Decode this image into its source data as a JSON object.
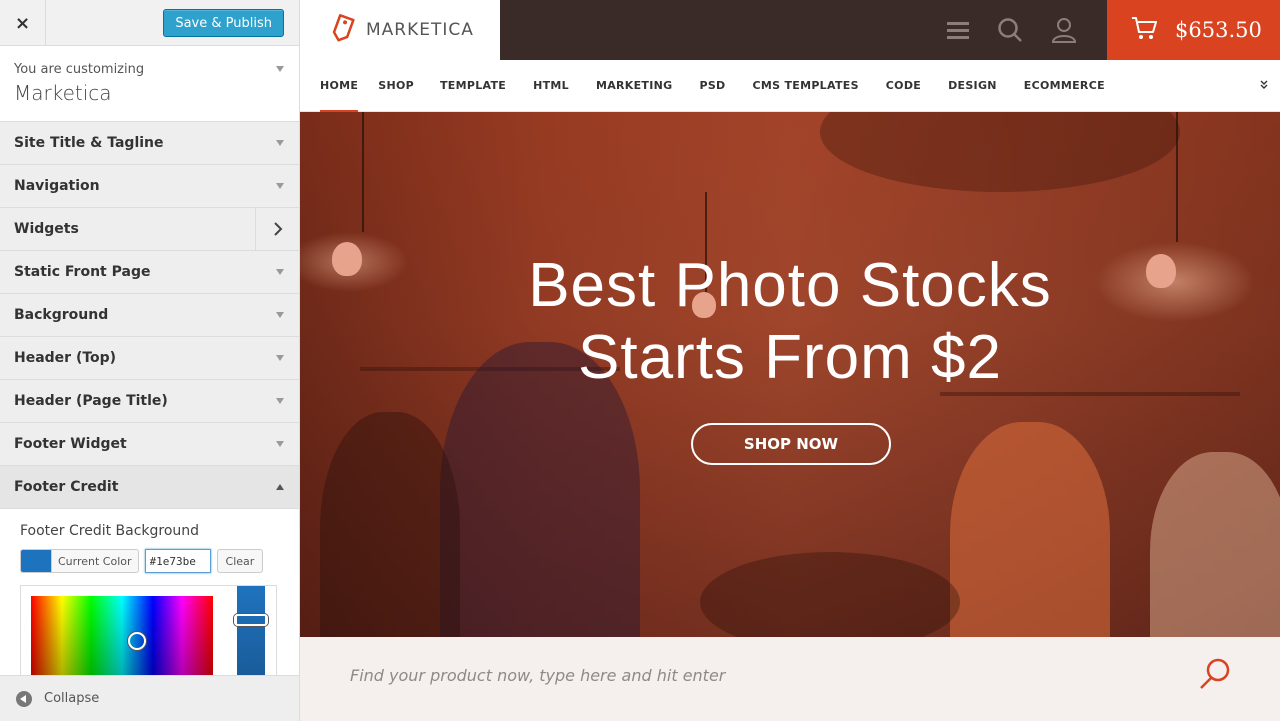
{
  "customizer": {
    "close_label": "×",
    "save_label": "Save & Publish",
    "customizing_prefix": "You are customizing",
    "theme_name": "Marketica",
    "sections": [
      {
        "label": "Site Title & Tagline"
      },
      {
        "label": "Navigation"
      },
      {
        "label": "Widgets"
      },
      {
        "label": "Static Front Page"
      },
      {
        "label": "Background"
      },
      {
        "label": "Header (Top)"
      },
      {
        "label": "Header (Page Title)"
      },
      {
        "label": "Footer Widget"
      },
      {
        "label": "Footer Credit"
      }
    ],
    "footer_credit": {
      "control_title": "Footer Credit Background",
      "current_color_label": "Current Color",
      "hex_value": "#1e73be",
      "clear_label": "Clear",
      "swatch_color": "#1e73be"
    },
    "collapse_label": "Collapse"
  },
  "site": {
    "logo_text": "MARKETICA",
    "cart_total": "$653.50",
    "accent_color": "#d9431f",
    "nav": [
      "HOME",
      "SHOP",
      "TEMPLATE",
      "HTML",
      "MARKETING",
      "PSD",
      "CMS TEMPLATES",
      "CODE",
      "DESIGN",
      "ECOMMERCE"
    ],
    "nav_more_icon": "double-chevron-down-icon",
    "hero": {
      "title_line1": "Best Photo Stocks",
      "title_line2": "Starts From $2",
      "button_label": "SHOP NOW"
    },
    "search": {
      "placeholder": "Find your product now, type here and hit enter"
    }
  }
}
